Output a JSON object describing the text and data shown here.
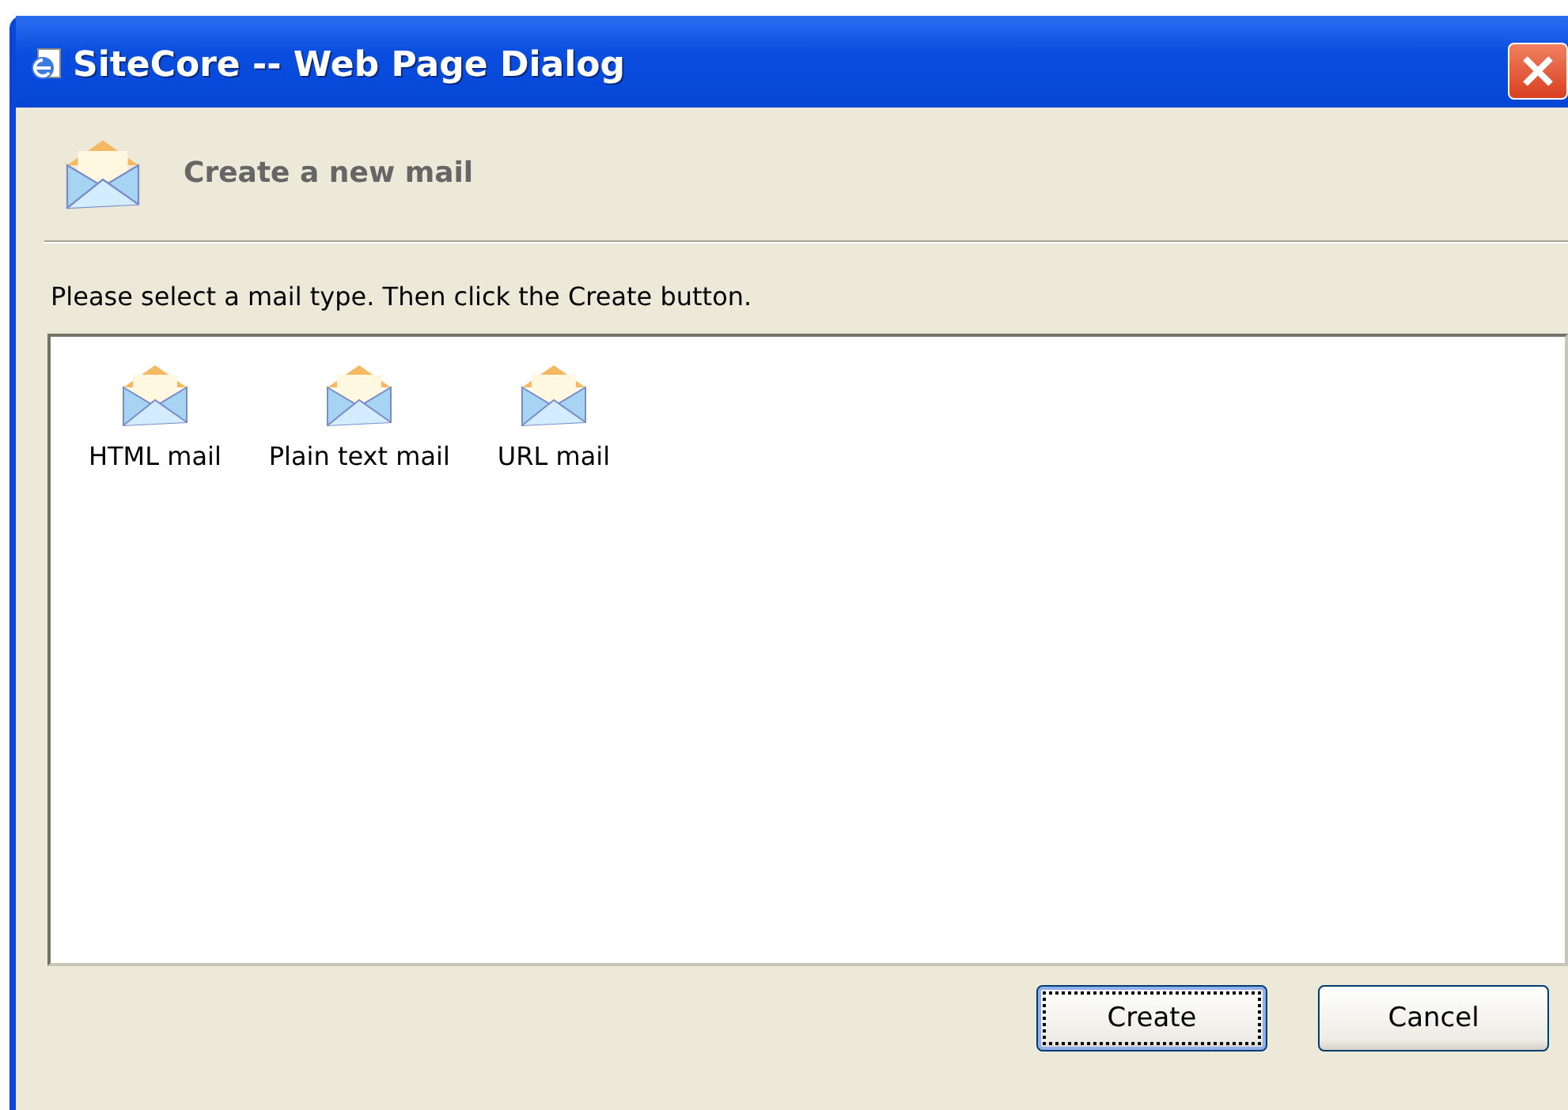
{
  "window": {
    "title": "SiteCore -- Web Page Dialog"
  },
  "header": {
    "title": "Create a new mail"
  },
  "instruction": "Please select a mail type. Then click the Create button.",
  "mail_types": [
    {
      "label": "HTML mail"
    },
    {
      "label": "Plain text mail"
    },
    {
      "label": "URL mail"
    }
  ],
  "buttons": [
    {
      "label": "Create",
      "default": true
    },
    {
      "label": "Cancel",
      "default": false
    }
  ]
}
